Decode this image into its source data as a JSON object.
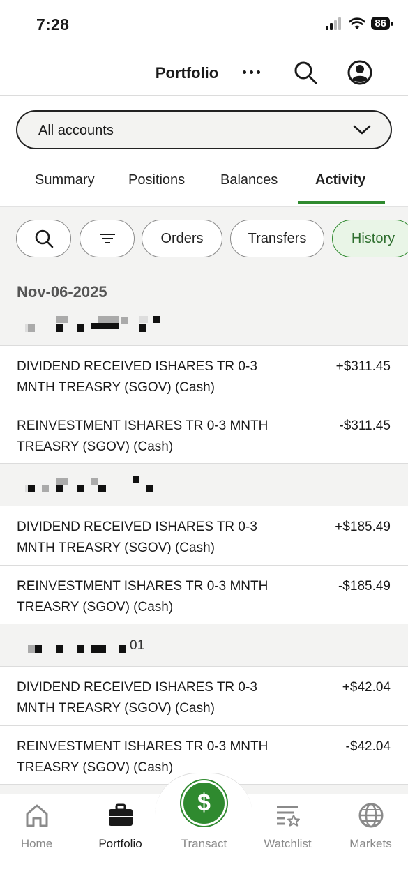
{
  "status_bar": {
    "time": "7:28",
    "battery": "86"
  },
  "header": {
    "title": "Portfolio"
  },
  "account_selector": {
    "value": "All accounts"
  },
  "tabs": [
    {
      "label": "Summary",
      "active": false
    },
    {
      "label": "Positions",
      "active": false
    },
    {
      "label": "Balances",
      "active": false
    },
    {
      "label": "Activity",
      "active": true
    }
  ],
  "filters": {
    "orders": "Orders",
    "transfers": "Transfers",
    "history": "History"
  },
  "activity": {
    "date": "Nov-06-2025",
    "groups": [
      {
        "account_suffix": "",
        "items": [
          {
            "description": "DIVIDEND RECEIVED ISHARES TR 0-3 MNTH TREASRY (SGOV) (Cash)",
            "amount": "+$311.45"
          },
          {
            "description": "REINVESTMENT ISHARES TR 0-3 MNTH TREASRY (SGOV) (Cash)",
            "amount": "-$311.45"
          }
        ]
      },
      {
        "account_suffix": "",
        "items": [
          {
            "description": "DIVIDEND RECEIVED ISHARES TR 0-3 MNTH TREASRY (SGOV) (Cash)",
            "amount": "+$185.49"
          },
          {
            "description": "REINVESTMENT ISHARES TR 0-3 MNTH TREASRY (SGOV) (Cash)",
            "amount": "-$185.49"
          }
        ]
      },
      {
        "account_suffix": "01",
        "items": [
          {
            "description": "DIVIDEND RECEIVED ISHARES TR 0-3 MNTH TREASRY (SGOV) (Cash)",
            "amount": "+$42.04"
          },
          {
            "description": "REINVESTMENT ISHARES TR 0-3 MNTH TREASRY (SGOV) (Cash)",
            "amount": "-$42.04"
          }
        ]
      }
    ]
  },
  "bottom_nav": {
    "home": "Home",
    "portfolio": "Portfolio",
    "transact": "Transact",
    "watchlist": "Watchlist",
    "markets": "Markets",
    "active": "Portfolio"
  },
  "colors": {
    "accent_green": "#2f8a2f",
    "chip_active_bg": "#e9f5e7",
    "content_bg": "#f3f3f2"
  }
}
